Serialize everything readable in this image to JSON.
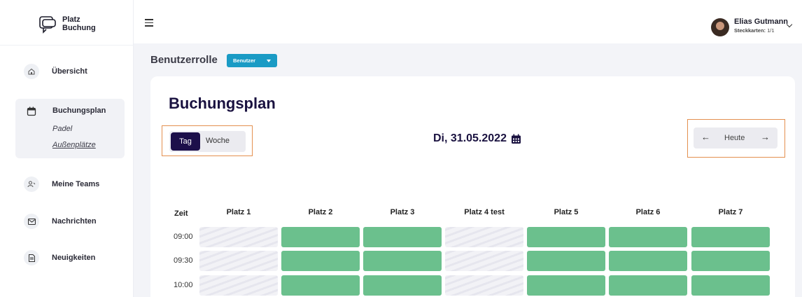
{
  "app": {
    "logo_line1": "Platz",
    "logo_line2": "Buchung"
  },
  "sidebar": {
    "items": [
      {
        "label": "Übersicht",
        "icon": "home-icon"
      },
      {
        "label": "Buchungsplan",
        "icon": "calendar-icon",
        "subitems": [
          "Padel",
          "Außenplätze"
        ]
      },
      {
        "label": "Meine Teams",
        "icon": "team-icon"
      },
      {
        "label": "Nachrichten",
        "icon": "mail-icon"
      },
      {
        "label": "Neuigkeiten",
        "icon": "news-icon"
      }
    ]
  },
  "user": {
    "name": "Elias Gutmann",
    "sub_label": "Steckkarten:",
    "sub_value": "1/1"
  },
  "role": {
    "label": "Benutzerrolle",
    "selected": "Benutzer"
  },
  "plan": {
    "title": "Buchungsplan",
    "view_tag": "Tag",
    "view_week": "Woche",
    "date": "Di, 31.05.2022",
    "today": "Heute",
    "time_header": "Zeit",
    "columns": [
      "Platz 1",
      "Platz 2",
      "Platz 3",
      "Platz 4 test",
      "Platz 5",
      "Platz 6",
      "Platz 7"
    ],
    "rows": [
      {
        "time": "09:00",
        "status": [
          "blocked",
          "free",
          "free",
          "blocked",
          "free",
          "free",
          "free"
        ]
      },
      {
        "time": "09:30",
        "status": [
          "blocked",
          "free",
          "free",
          "blocked",
          "free",
          "free",
          "free"
        ]
      },
      {
        "time": "10:00",
        "status": [
          "blocked",
          "free",
          "free",
          "blocked",
          "free",
          "free",
          "free"
        ]
      }
    ]
  },
  "colors": {
    "free": "#6bc08d",
    "accent": "#1c0f4a",
    "role_button": "#1a9bc5",
    "highlight": "#e4904f"
  }
}
